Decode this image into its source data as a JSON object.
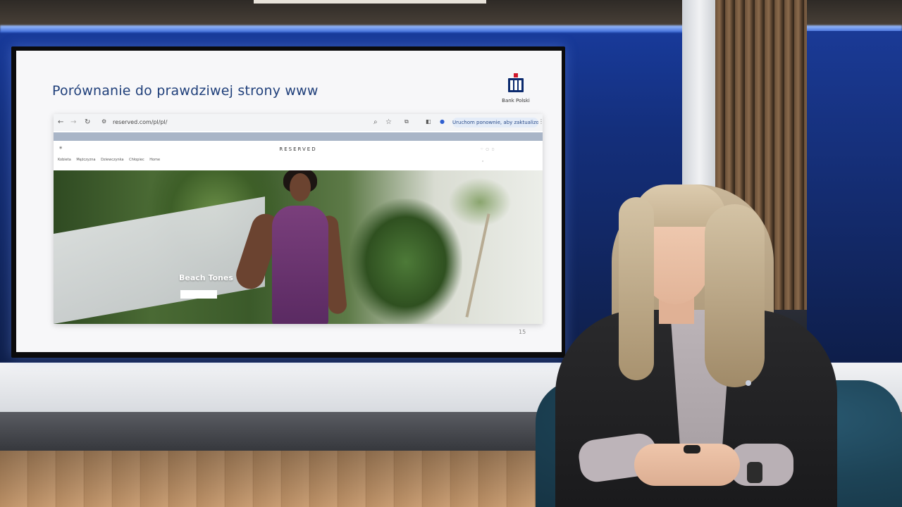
{
  "slide": {
    "title": "Porównanie do prawdziwej strony www",
    "logo_text": "Bank Polski",
    "page_number": "15"
  },
  "browser": {
    "url": "reserved.com/pl/pl/",
    "update_button": "Uruchom ponownie, aby zaktualizować",
    "brand": "RESERVED",
    "categories": [
      "Kobieta",
      "Mężczyzna",
      "Dziewczynka",
      "Chłopiec",
      "Home"
    ],
    "hero_title": "Beach Tones"
  },
  "icons": [
    "back-arrow-icon",
    "forward-arrow-icon",
    "reload-icon",
    "search-icon",
    "star-icon",
    "extensions-icon",
    "sidebar-icon",
    "profile-icon",
    "menu-icon"
  ],
  "colors": {
    "title_blue": "#1f3f7a",
    "studio_blue": "#183a9a",
    "dress_purple": "#7a3f7c"
  }
}
